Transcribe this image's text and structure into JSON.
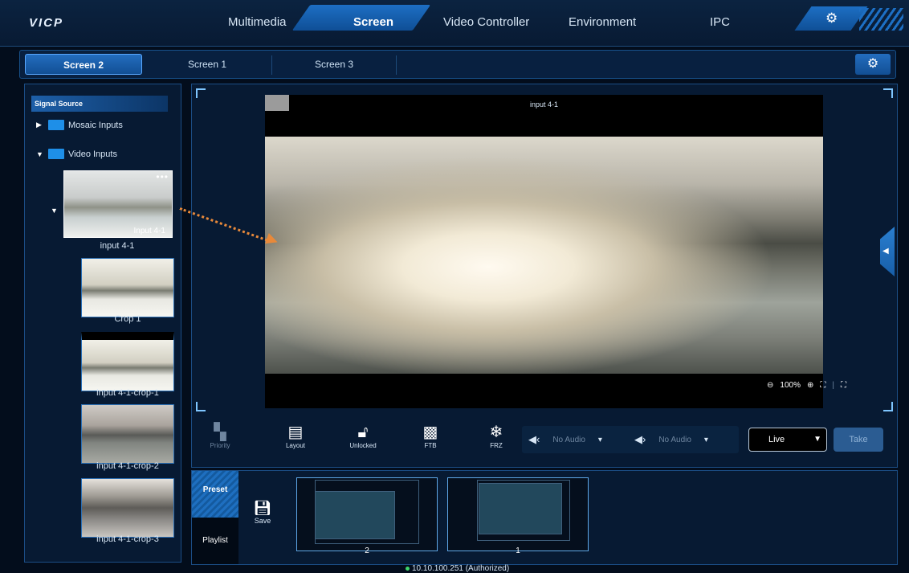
{
  "app": {
    "logo": "VICP"
  },
  "nav": {
    "items": [
      "Multimedia",
      "Screen",
      "Video Controller",
      "Environment",
      "IPC"
    ],
    "active": "Screen"
  },
  "screen_tabs": {
    "items": [
      "Screen 2",
      "Screen 1",
      "Screen 3"
    ],
    "active": "Screen 2"
  },
  "signal_source": {
    "header": "Signal Source",
    "folders": [
      "Mosaic Inputs",
      "Video Inputs"
    ],
    "thumbnails": [
      {
        "label": "input 4-1",
        "overlay": "Input 4-1"
      },
      {
        "label": "Crop 1"
      },
      {
        "label": "input 4-1-crop-1"
      },
      {
        "label": "input 4-1-crop-2"
      },
      {
        "label": "input 4-1-crop-3"
      }
    ]
  },
  "preview": {
    "title": "input 4-1",
    "zoom": "100%"
  },
  "toolbar": {
    "priority": "Priority",
    "layout": "Layout",
    "unlocked": "Unlocked",
    "ftb": "FTB",
    "frz": "FRZ",
    "audio_in": "No Audio",
    "audio_out": "No Audio",
    "mode": "Live",
    "take": "Take"
  },
  "bottom": {
    "tab_preset": "Preset",
    "tab_playlist": "Playlist",
    "save": "Save",
    "presets": [
      "2",
      "1"
    ]
  },
  "status": {
    "text": "10.10.100.251 (Authorized)",
    "color": "#3ed66b"
  }
}
